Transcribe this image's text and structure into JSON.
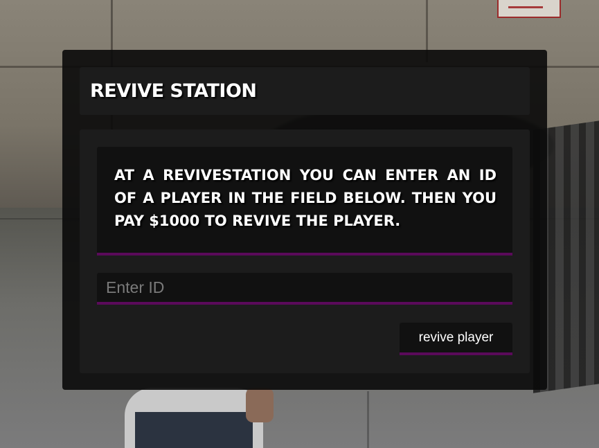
{
  "window": {
    "title": "REVIVE STATION"
  },
  "info": {
    "text": "AT A REVIVESTATION YOU CAN ENTER AN ID OF A PLAYER IN THE FIELD BELOW. THEN YOU PAY $1000 TO REVIVE THE PLAYER."
  },
  "id_input": {
    "value": "",
    "placeholder": "Enter ID"
  },
  "revive_button": {
    "label": "revive player"
  },
  "colors": {
    "accent": "#5a0a5a",
    "panel_background": "#1c1c1c",
    "field_background": "#111111",
    "text": "#ffffff"
  }
}
